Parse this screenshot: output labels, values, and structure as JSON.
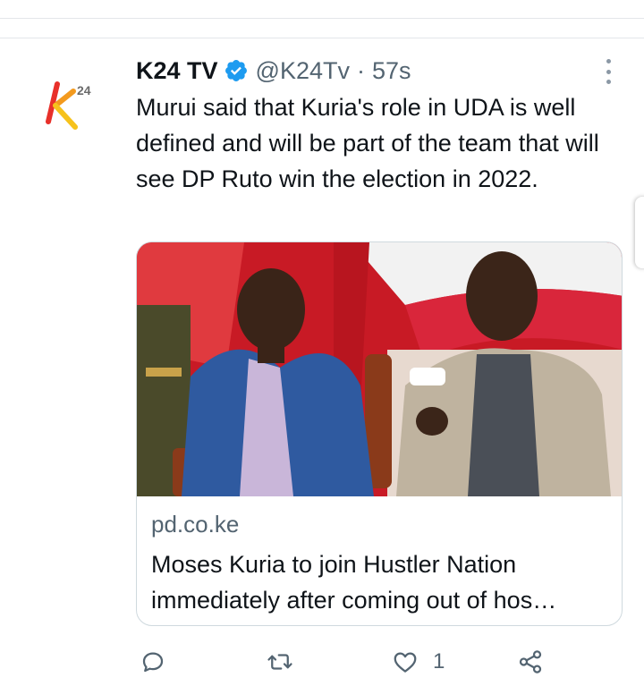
{
  "tweet": {
    "display_name": "K24 TV",
    "handle": "@K24Tv",
    "separator": "·",
    "timestamp": "57s",
    "text": "Murui said that Kuria's role in UDA is well defined and will be part of the team that will see DP Ruto win the election in 2022.",
    "avatar_icon": "k24-logo",
    "verified_icon": "verified-badge-icon",
    "accent_color": "#1d9bf0"
  },
  "card": {
    "domain": "pd.co.ke",
    "title": "Moses Kuria to join Hustler Nation immediately after coming out of hos…",
    "image_description_icon": "photo-two-men-seated"
  },
  "actions": {
    "reply_icon": "reply-icon",
    "retweet_icon": "retweet-icon",
    "like_icon": "heart-icon",
    "like_count": "1",
    "share_icon": "share-icon"
  }
}
